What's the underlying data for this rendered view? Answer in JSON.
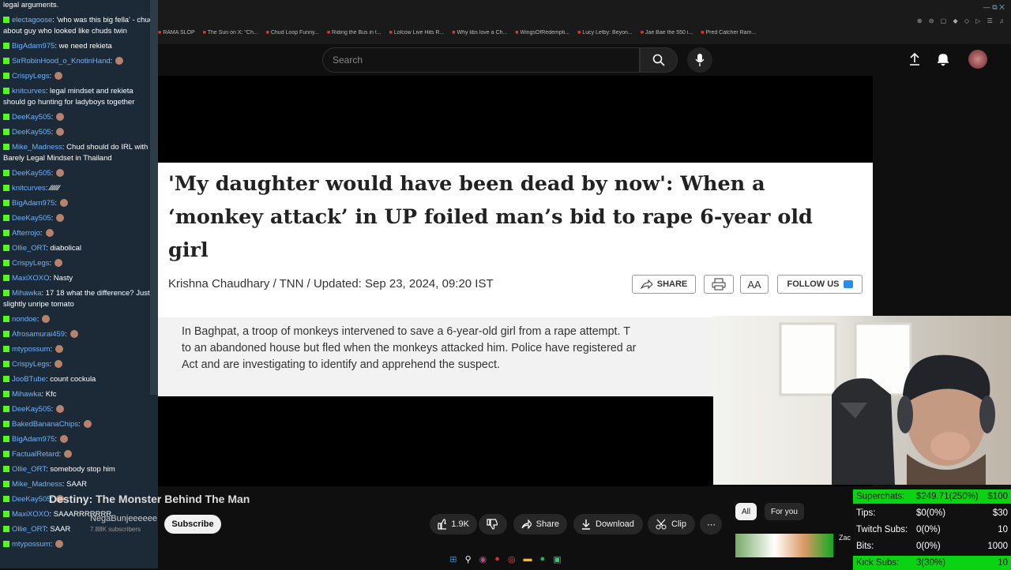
{
  "browser": {
    "bookmarks": [
      "RAMA SLOP",
      "The Sun on X: \"Ch...",
      "Chud Loop Funny...",
      "Riding the Bus in t...",
      "Lolcow Live Hits R...",
      "Why libs love a Ch...",
      "WingsOfRedempti...",
      "Lucy Letby: Beyon...",
      "Jae Bae the 550 i...",
      "Pred Catcher Ram..."
    ],
    "window_controls": "—  ⧉  ✕",
    "toolbar_icons": "⊕ ⊖ ▢ ◆ ◇ ▷ ☰ ♫"
  },
  "youtube": {
    "search_placeholder": "Search",
    "video_title": "Destiny: The Monster Behind The Man",
    "channel_name": "NegaBunjeeeeee",
    "subscriber_count": "7.88K subscribers",
    "subscribe_label": "Subscribe",
    "like_count": "1.9K",
    "share_label": "Share",
    "download_label": "Download",
    "clip_label": "Clip",
    "chips": [
      "All",
      "For you"
    ],
    "related_title": "Zac"
  },
  "article": {
    "headline": "'My daughter would have been dead by now': When a ‘monkey attack’ in UP foiled man’s bid to rape 6-year old girl",
    "byline": "Krishna Chaudhary / TNN / Updated: Sep 23, 2024, 09:20 IST",
    "share_label": "SHARE",
    "aa_label": "AA",
    "follow_label": "FOLLOW US",
    "summary_lines": [
      "In Baghpat, a troop of monkeys intervened to save a 6-year-old girl from a rape attempt. T",
      "to an abandoned house but fled when the monkeys attacked him. Police have registered ar",
      "Act and are investigating to identify and apprehend the suspect."
    ]
  },
  "chat": {
    "messages": [
      {
        "user": "",
        "text": "legal arguments."
      },
      {
        "user": "electagoose",
        "text": ": 'who was this big fella' - chud about guy who looked like chuds twin"
      },
      {
        "user": "BigAdam975",
        "text": ": we need rekieta"
      },
      {
        "user": "SirRobinHood_o_KnotinHand",
        "text": ":"
      },
      {
        "user": "CrispyLegs",
        "text": ":"
      },
      {
        "user": "knitcurves",
        "text": ": legal mindset and rekieta should go hunting for ladyboys together"
      },
      {
        "user": "DeeKay505",
        "text": ":"
      },
      {
        "user": "DeeKay505",
        "text": ":"
      },
      {
        "user": "Mike_Madness",
        "text": ": Chud should do IRL with Barely Legal Mindset in Thailand"
      },
      {
        "user": "DeeKay505",
        "text": ":"
      },
      {
        "user": "knitcurves",
        "text": ": ⁄⁄⁄⁄⁄⁄⁄⁄"
      },
      {
        "user": "BigAdam975",
        "text": ":"
      },
      {
        "user": "DeeKay505",
        "text": ":"
      },
      {
        "user": "Afterrojo",
        "text": ":"
      },
      {
        "user": "Ollie_ORT",
        "text": ": diabolical"
      },
      {
        "user": "CrispyLegs",
        "text": ":"
      },
      {
        "user": "MaxiXOXO",
        "text": ": Nasty"
      },
      {
        "user": "Mihawka",
        "text": ": 17 18 what the difference? Just slightly unripe tomato"
      },
      {
        "user": "nondoe",
        "text": ":"
      },
      {
        "user": "Afrosamurai459",
        "text": ":"
      },
      {
        "user": "mtypossum",
        "text": ":"
      },
      {
        "user": "CrispyLegs",
        "text": ":"
      },
      {
        "user": "JooBTube",
        "text": ": count cockula"
      },
      {
        "user": "Mihawka",
        "text": ": Kfc"
      },
      {
        "user": "DeeKay505",
        "text": ":"
      },
      {
        "user": "BakedBananaChips",
        "text": ":"
      },
      {
        "user": "BigAdam975",
        "text": ":"
      },
      {
        "user": "FactualRetard",
        "text": ":"
      },
      {
        "user": "Ollie_ORT",
        "text": ": somebody stop him"
      },
      {
        "user": "Mike_Madness",
        "text": ": SAAR"
      },
      {
        "user": "DeeKay505",
        "text": ":"
      },
      {
        "user": "MaxiXOXO",
        "text": ": SAAARRRRRRR"
      },
      {
        "user": "Ollie_ORT",
        "text": ": SAAR"
      },
      {
        "user": "mtypossum",
        "text": ":"
      }
    ]
  },
  "stats": {
    "rows": [
      {
        "label": "Superchats:",
        "mid": "$249.71(250%)",
        "right": "$100",
        "highlight": true
      },
      {
        "label": "Tips:",
        "mid": "$0(0%)",
        "right": "$30",
        "highlight": false
      },
      {
        "label": "Twitch Subs:",
        "mid": "0(0%)",
        "right": "10",
        "highlight": false
      },
      {
        "label": "Bits:",
        "mid": "0(0%)",
        "right": "1000",
        "highlight": false
      },
      {
        "label": "Kick Subs:",
        "mid": "3(30%)",
        "right": "10",
        "highlight": true
      }
    ]
  },
  "colors": {
    "accent_green": "#09d312",
    "kick_green": "#53fc18",
    "chat_bg": "#1c2a38",
    "yt_bg": "#0f0f0f"
  }
}
